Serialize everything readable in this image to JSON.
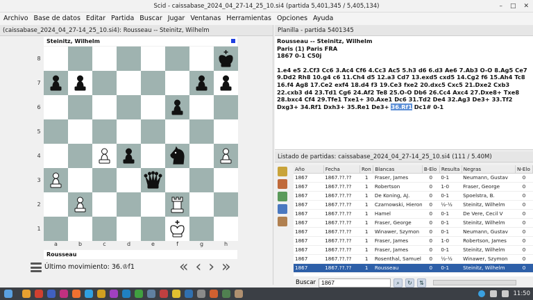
{
  "window": {
    "title": "Scid - caissabase_2024_04_27-14_25_10.si4 (partida 5,401,345 / 5,405,134)",
    "buttons": [
      "–",
      "□",
      "✕"
    ]
  },
  "menu": [
    "Archivo",
    "Base de datos",
    "Editar",
    "Partida",
    "Buscar",
    "Jugar",
    "Ventanas",
    "Herramientas",
    "Opciones",
    "Ayuda"
  ],
  "board_pane": {
    "tab": "(caissabase_2024_04_27-14_25_10.si4): Rousseau -- Steinitz, Wilhelm",
    "top_player": "Steinitz, Wilhelm",
    "bottom_player": "Rousseau",
    "last_move_label": "Último movimiento: 36.♔f1",
    "ranks": [
      "8",
      "7",
      "6",
      "5",
      "4",
      "3",
      "2",
      "1"
    ],
    "files": [
      "a",
      "b",
      "c",
      "d",
      "e",
      "f",
      "g",
      "h"
    ],
    "nav": [
      "«",
      "‹",
      "›",
      "»"
    ],
    "position": [
      [
        "",
        "",
        "",
        "",
        "",
        "",
        "",
        "bK"
      ],
      [
        "bP",
        "bP",
        "",
        "",
        "",
        "",
        "bP",
        "bP"
      ],
      [
        "",
        "",
        "",
        "",
        "",
        "bP",
        "",
        ""
      ],
      [
        "",
        "",
        "",
        "",
        "",
        "",
        "",
        ""
      ],
      [
        "",
        "",
        "wP",
        "bP",
        "",
        "bN",
        "",
        "wP"
      ],
      [
        "wP",
        "",
        "",
        "",
        "bQ",
        "",
        "",
        ""
      ],
      [
        "",
        "wP",
        "",
        "",
        "",
        "wR",
        "",
        ""
      ],
      [
        "",
        "",
        "",
        "",
        "",
        "wK",
        "",
        ""
      ]
    ]
  },
  "notation_pane": {
    "tab": "Planilla - partida 5401345",
    "header_line1": "Rousseau   --   Steinitz, Wilhelm",
    "header_line2": "Paris (1)  Paris FRA",
    "header_line3": "1867  0-1  C50j",
    "moves_before": "1.e4 e5 2.Cf3 Cc6 3.Ac4 Cf6 4.Cc3 Ac5 5.h3 d6 6.d3 Ae6 7.Ab3 O-O 8.Ag5 Ce7 9.Dd2 Rh8 10.g4 c6 11.Ch4 d5 12.a3 Cd7 13.exd5 cxd5 14.Cg2 f6 15.Ah4 Tc8 16.f4 Ag8 17.Ce2 exf4 18.d4 f3 19.Ce3 fxe2 20.dxc5 Cxc5 21.Dxe2 Cxb3 22.cxb3 d4 23.Td1 Cg6 24.Af2 Te8 25.O-O Db6 26.Cc4 Axc4 27.Dxe8+ Txe8 28.bxc4 Cf4 29.Tfe1 Txe1+ 30.Axe1 Dc6 31.Td2 De4 32.Ag3 De3+ 33.Tf2 Dxg3+ 34.Rf1 Dxh3+ 35.Re1 De3+",
    "current_move": "36.Rf1",
    "moves_after": "Dc1# 0-1"
  },
  "list_pane": {
    "tab": "Listado de partidas: caissabase_2024_04_27-14_25_10.si4 (111 / 5.40M)",
    "columns": [
      "Año",
      "Fecha",
      "Ron",
      "Blancas",
      "B-Elo",
      "Resulta",
      "Negras",
      "N-Elo"
    ],
    "rows": [
      [
        "1867",
        "1867.??.??",
        "1",
        "Fraser, James",
        "0",
        "0-1",
        "Neumann, Gustav",
        "0"
      ],
      [
        "1867",
        "1867.??.??",
        "1",
        "Robertson",
        "0",
        "1-0",
        "Fraser, George",
        "0"
      ],
      [
        "1867",
        "1867.??.??",
        "1",
        "De Koning, AJ.",
        "0",
        "0-1",
        "Spoelstra, B.",
        "0"
      ],
      [
        "1867",
        "1867.??.??",
        "1",
        "Czarnowski, Hieron",
        "0",
        "½-½",
        "Steinitz, Wilhelm",
        "0"
      ],
      [
        "1867",
        "1867.??.??",
        "1",
        "Hamel",
        "0",
        "0-1",
        "De Vere, Cecil V",
        "0"
      ],
      [
        "1867",
        "1867.??.??",
        "1",
        "Fraser, George",
        "0",
        "0-1",
        "Steinitz, Wilhelm",
        "0"
      ],
      [
        "1867",
        "1867.??.??",
        "1",
        "Winawer, Szymon",
        "0",
        "0-1",
        "Neumann, Gustav",
        "0"
      ],
      [
        "1867",
        "1867.??.??",
        "1",
        "Fraser, James",
        "0",
        "1-0",
        "Robertson, James",
        "0"
      ],
      [
        "1867",
        "1867.??.??",
        "1",
        "Fraser, James",
        "0",
        "0-1",
        "Steinitz, Wilhelm",
        "0"
      ],
      [
        "1867",
        "1867.??.??",
        "1",
        "Rosenthal, Samuel",
        "0",
        "½-½",
        "Winawer, Szymon",
        "0"
      ],
      [
        "1867",
        "1867.??.??",
        "1",
        "Rousseau",
        "0",
        "0-1",
        "Steinitz, Wilhelm",
        "0"
      ]
    ],
    "selected_row": 10,
    "search_label": "Buscar",
    "search_value": "1867"
  },
  "taskbar": {
    "clock": "11:50"
  },
  "colors": {
    "dark_square": "#9fb3b0",
    "light_square": "#ffffff",
    "selection": "#2d5fa8"
  }
}
